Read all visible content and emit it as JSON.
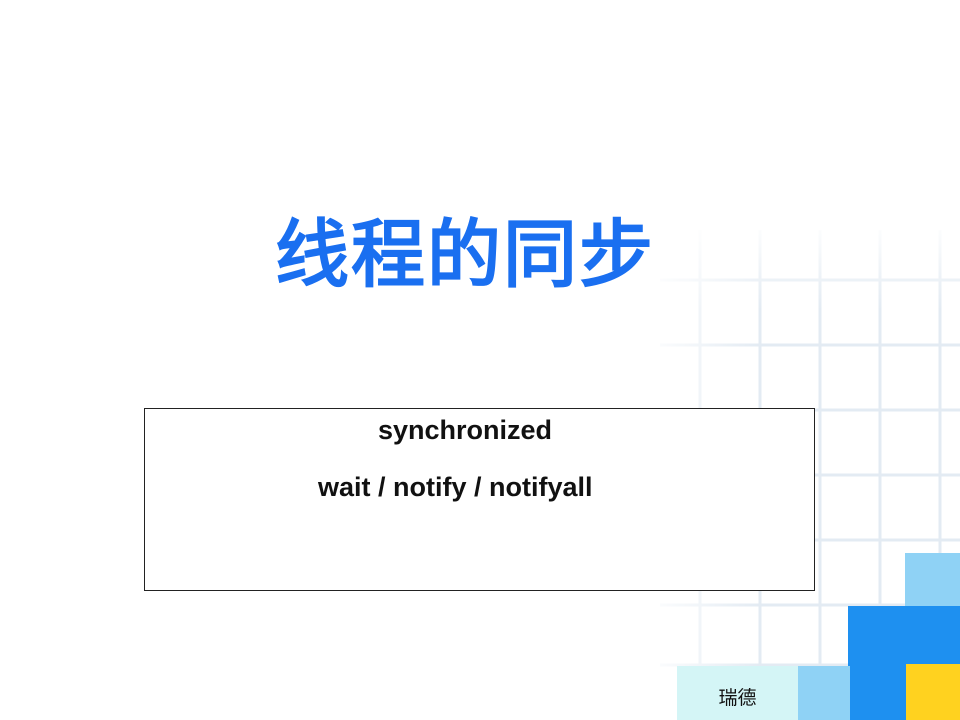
{
  "slide": {
    "title": "线程的同步",
    "content_lines": [
      "synchronized",
      "wait / notify / notifyall"
    ],
    "footer": "瑞德"
  },
  "colors": {
    "title": "#1a6ff0",
    "grid_light": "#e6eef6",
    "block_light_blue": "#8fd2f5",
    "block_blue": "#1e90f0",
    "block_yellow": "#ffd21f",
    "footer_bg": "#d4f5f6"
  }
}
